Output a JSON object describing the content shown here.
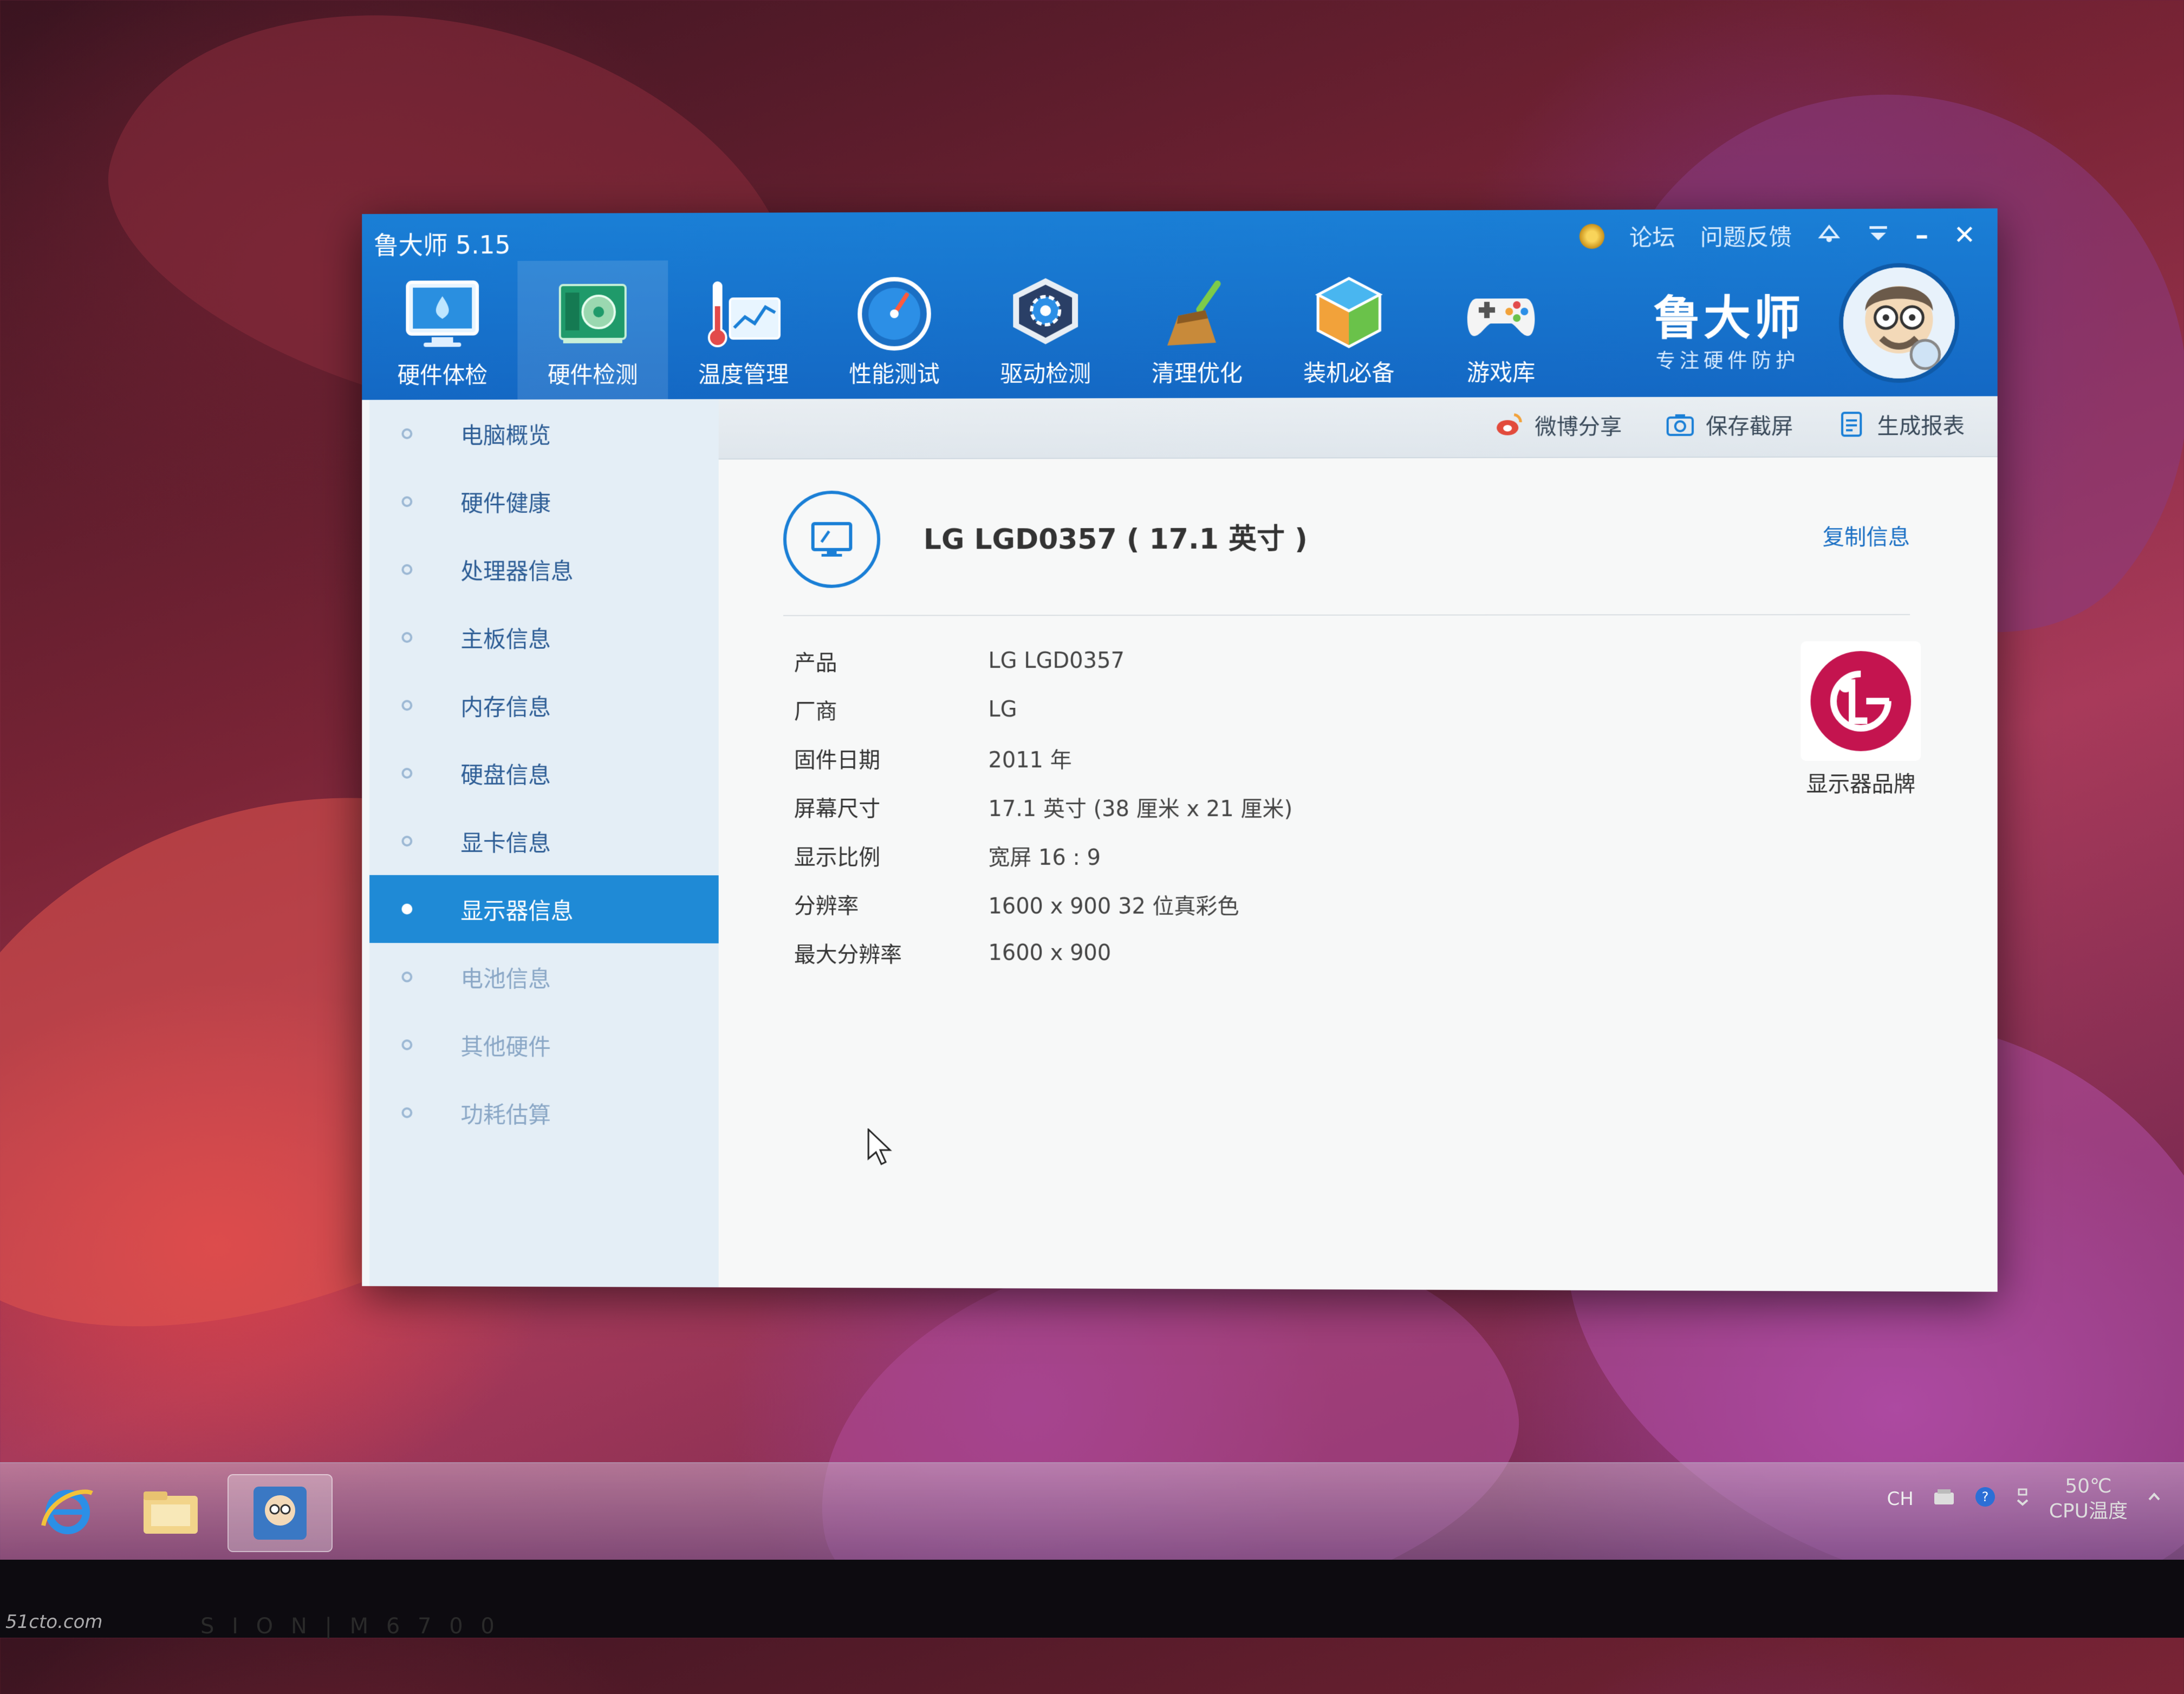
{
  "window": {
    "title": "鲁大师 5.15",
    "links": {
      "forum": "论坛",
      "feedback": "问题反馈"
    },
    "controls": {
      "minimize": "–",
      "close": "✕"
    }
  },
  "toolbar": {
    "items": [
      {
        "label": "硬件体检",
        "icon": "monitor-water-icon"
      },
      {
        "label": "硬件检测",
        "icon": "circuit-board-icon"
      },
      {
        "label": "温度管理",
        "icon": "thermometer-chart-icon"
      },
      {
        "label": "性能测试",
        "icon": "speedometer-icon"
      },
      {
        "label": "驱动检测",
        "icon": "gear-box-icon"
      },
      {
        "label": "清理优化",
        "icon": "broom-icon"
      },
      {
        "label": "装机必备",
        "icon": "cube-icon"
      },
      {
        "label": "游戏库",
        "icon": "gamepad-icon"
      }
    ],
    "active_index": 1
  },
  "brand": {
    "name": "鲁大师",
    "slogan": "专注硬件防护"
  },
  "sidebar": {
    "items": [
      {
        "label": "电脑概览"
      },
      {
        "label": "硬件健康"
      },
      {
        "label": "处理器信息"
      },
      {
        "label": "主板信息"
      },
      {
        "label": "内存信息"
      },
      {
        "label": "硬盘信息"
      },
      {
        "label": "显卡信息"
      },
      {
        "label": "显示器信息"
      },
      {
        "label": "电池信息"
      },
      {
        "label": "其他硬件"
      },
      {
        "label": "功耗估算"
      }
    ],
    "active_index": 7
  },
  "actions": {
    "share": "微博分享",
    "screenshot": "保存截屏",
    "report": "生成报表"
  },
  "monitor": {
    "title": "LG LGD0357 ( 17.1 英寸 )",
    "copy_label": "复制信息",
    "brand_label": "显示器品牌",
    "specs": [
      {
        "key": "产品",
        "value": "LG LGD0357"
      },
      {
        "key": "厂商",
        "value": "LG"
      },
      {
        "key": "固件日期",
        "value": "2011 年"
      },
      {
        "key": "屏幕尺寸",
        "value": "17.1 英寸 (38 厘米 x 21 厘米)"
      },
      {
        "key": "显示比例",
        "value": "宽屏 16 : 9"
      },
      {
        "key": "分辨率",
        "value": "1600 x 900 32 位真彩色"
      },
      {
        "key": "最大分辨率",
        "value": "1600 x 900"
      }
    ]
  },
  "taskbar": {
    "lang": "CH",
    "cpu_temp": "50℃",
    "cpu_temp_label": "CPU温度"
  },
  "bezel_text": "S I O N | M 6 7 0 0",
  "watermark": "51cto.com",
  "colors": {
    "accent": "#1a7fd6",
    "sidebar_active": "#1f8ad6",
    "link": "#1a6fc4"
  }
}
